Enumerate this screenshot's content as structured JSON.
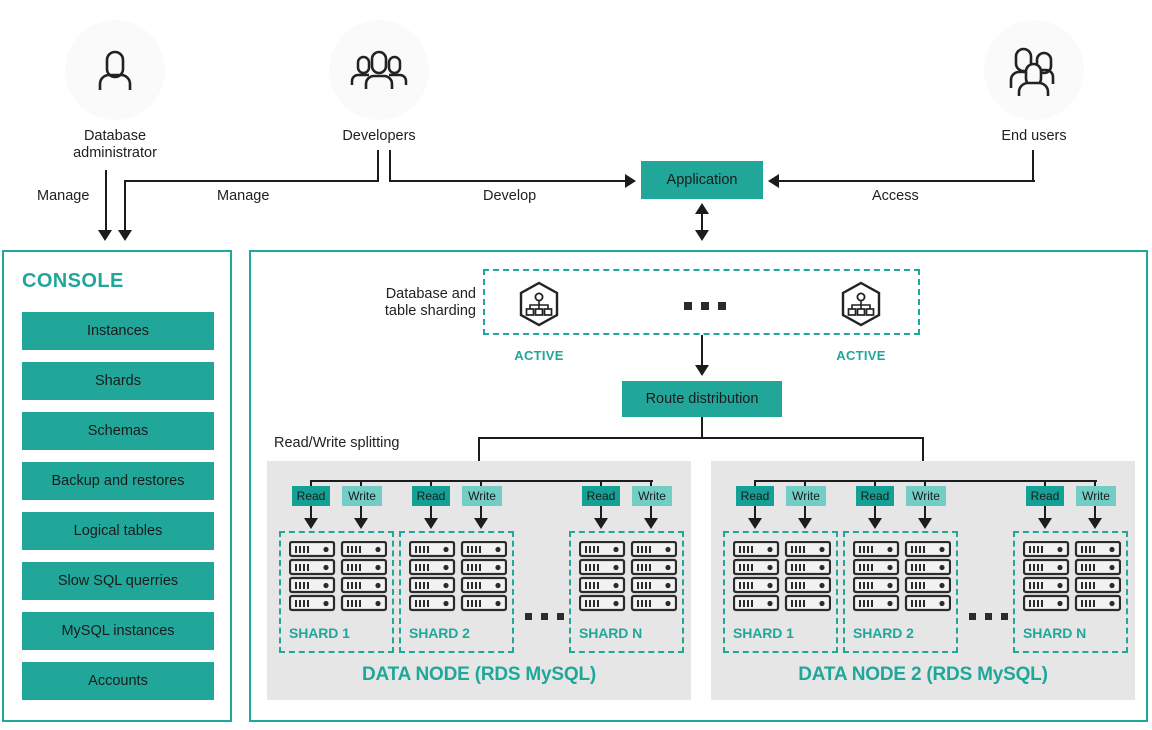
{
  "actors": [
    {
      "id": "database-administrator",
      "label": "Database\nadministrator",
      "icon": "user-icon"
    },
    {
      "id": "developers",
      "label": "Developers",
      "icon": "users-three-icon"
    },
    {
      "id": "end-users",
      "label": "End users",
      "icon": "users-group-icon"
    }
  ],
  "edges": {
    "manage_left": "Manage",
    "manage_right": "Manage",
    "develop": "Develop",
    "access": "Access"
  },
  "application": {
    "label": "Application"
  },
  "console": {
    "title": "CONSOLE",
    "items": [
      {
        "label": "Instances"
      },
      {
        "label": "Shards"
      },
      {
        "label": "Schemas"
      },
      {
        "label": "Backup and restores"
      },
      {
        "label": "Logical tables"
      },
      {
        "label": "Slow SQL querries"
      },
      {
        "label": "MySQL instances"
      },
      {
        "label": "Accounts"
      }
    ]
  },
  "sharding": {
    "side_label": "Database and\ntable sharding",
    "nodes": [
      {
        "icon": "sharding-hexagon-icon",
        "status": "ACTIVE"
      },
      {
        "icon": "sharding-hexagon-icon",
        "status": "ACTIVE"
      }
    ],
    "ellipsis": "..."
  },
  "route": {
    "label": "Route distribution"
  },
  "read_write": {
    "label": "Read/Write splitting"
  },
  "data_nodes": [
    {
      "title": "DATA NODE (RDS MySQL)",
      "groups": [
        {
          "read": "Read",
          "write": "Write",
          "shard": "SHARD 1",
          "servers": 8
        },
        {
          "read": "Read",
          "write": "Write",
          "shard": "SHARD 2",
          "servers": 8
        },
        {
          "read": "Read",
          "write": "Write",
          "shard": "SHARD N",
          "servers": 8
        }
      ],
      "ellipsis": "..."
    },
    {
      "title": "DATA NODE 2 (RDS MySQL)",
      "groups": [
        {
          "read": "Read",
          "write": "Write",
          "shard": "SHARD 1",
          "servers": 8
        },
        {
          "read": "Read",
          "write": "Write",
          "shard": "SHARD 2",
          "servers": 8
        },
        {
          "read": "Read",
          "write": "Write",
          "shard": "SHARD N",
          "servers": 8
        }
      ],
      "ellipsis": "..."
    }
  ],
  "colors": {
    "teal": "#21a79a",
    "teal_dark": "#14a094",
    "teal_light": "#72cdc4",
    "panel_bg": "#e6e6e6",
    "line": "#1c1c1c"
  }
}
